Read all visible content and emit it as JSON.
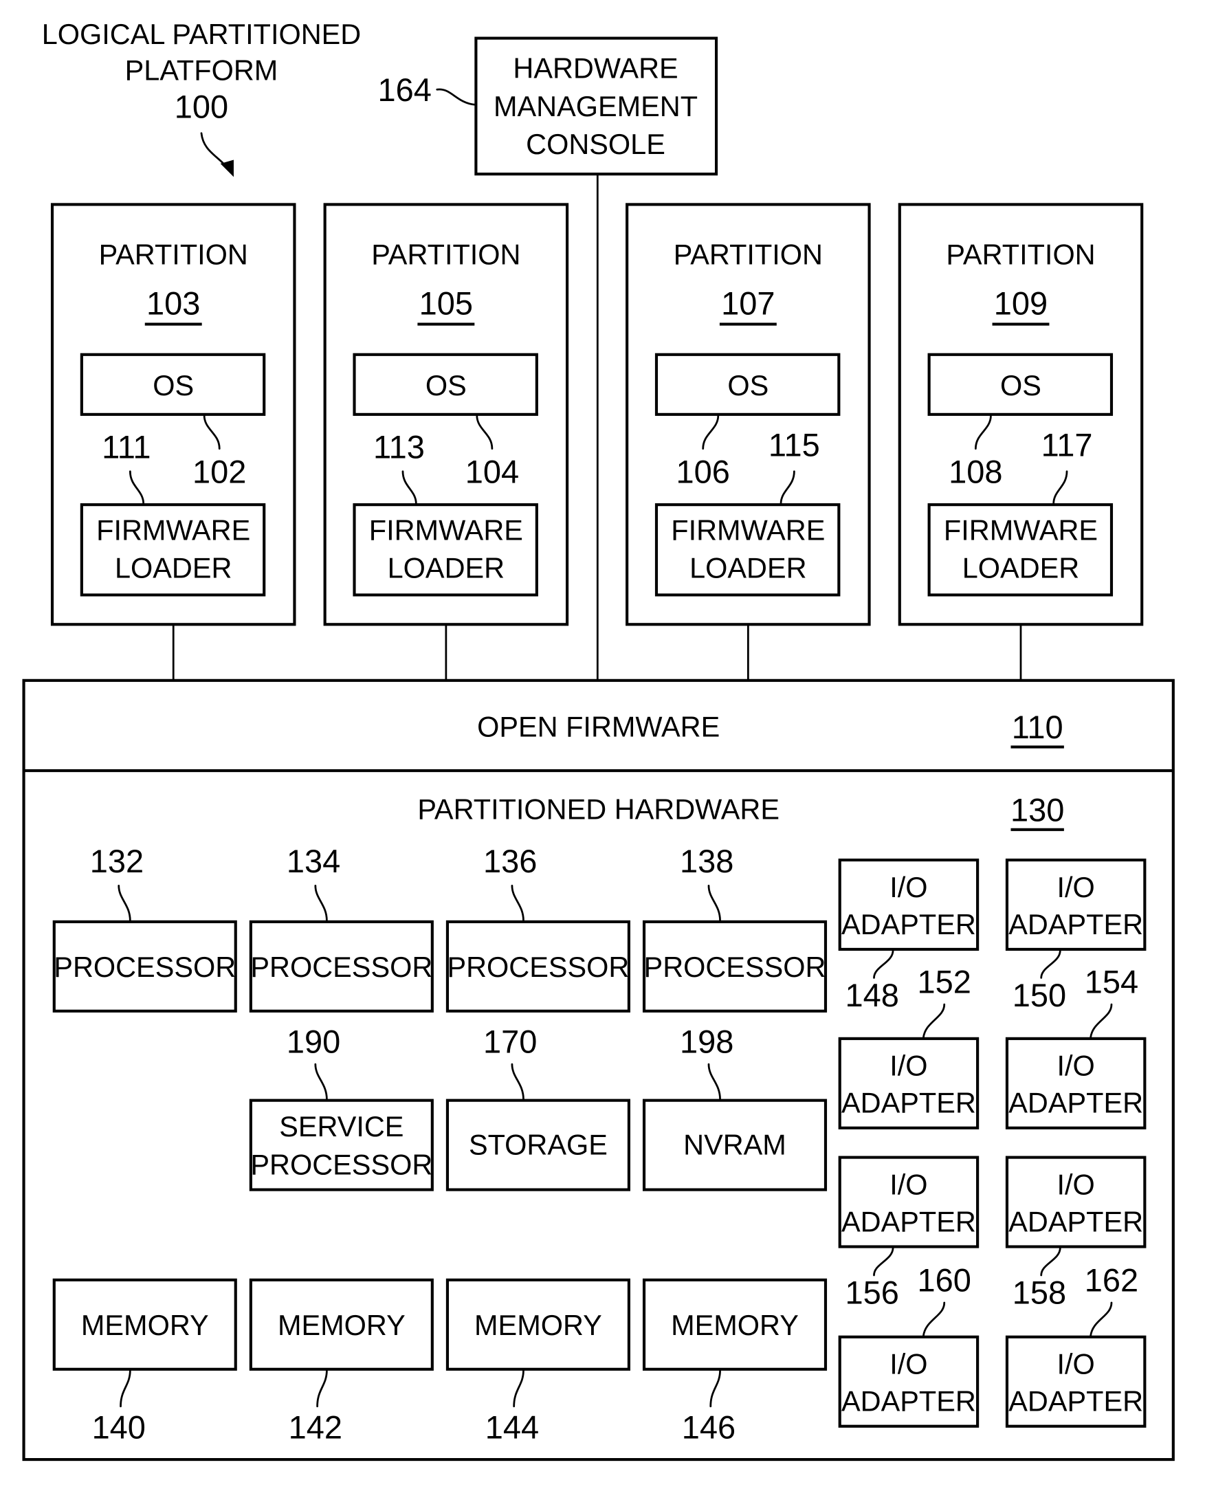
{
  "figure": {
    "title_line1": "LOGICAL PARTITIONED",
    "title_line2": "PLATFORM",
    "title_ref": "100"
  },
  "hmc": {
    "ref": "164",
    "line1": "HARDWARE",
    "line2": "MANAGEMENT",
    "line3": "CONSOLE"
  },
  "partitions": [
    {
      "label": "PARTITION",
      "ref": "103",
      "os": "OS",
      "os_ref": "102",
      "loader_line1": "FIRMWARE",
      "loader_line2": "LOADER",
      "loader_ref": "111"
    },
    {
      "label": "PARTITION",
      "ref": "105",
      "os": "OS",
      "os_ref": "104",
      "loader_line1": "FIRMWARE",
      "loader_line2": "LOADER",
      "loader_ref": "113"
    },
    {
      "label": "PARTITION",
      "ref": "107",
      "os": "OS",
      "os_ref": "106",
      "loader_line1": "FIRMWARE",
      "loader_line2": "LOADER",
      "loader_ref": "115"
    },
    {
      "label": "PARTITION",
      "ref": "109",
      "os": "OS",
      "os_ref": "108",
      "loader_line1": "FIRMWARE",
      "loader_line2": "LOADER",
      "loader_ref": "117"
    }
  ],
  "open_firmware": {
    "label": "OPEN FIRMWARE",
    "ref": "110"
  },
  "hardware": {
    "label": "PARTITIONED HARDWARE",
    "ref": "130",
    "processors": [
      {
        "label": "PROCESSOR",
        "ref": "132"
      },
      {
        "label": "PROCESSOR",
        "ref": "134"
      },
      {
        "label": "PROCESSOR",
        "ref": "136"
      },
      {
        "label": "PROCESSOR",
        "ref": "138"
      }
    ],
    "service_processor": {
      "line1": "SERVICE",
      "line2": "PROCESSOR",
      "ref": "190"
    },
    "storage": {
      "label": "STORAGE",
      "ref": "170"
    },
    "nvram": {
      "label": "NVRAM",
      "ref": "198"
    },
    "memories": [
      {
        "label": "MEMORY",
        "ref": "140"
      },
      {
        "label": "MEMORY",
        "ref": "142"
      },
      {
        "label": "MEMORY",
        "ref": "144"
      },
      {
        "label": "MEMORY",
        "ref": "146"
      }
    ],
    "io_adapters": [
      {
        "line1": "I/O",
        "line2": "ADAPTER",
        "ref": "148"
      },
      {
        "line1": "I/O",
        "line2": "ADAPTER",
        "ref": "150"
      },
      {
        "line1": "I/O",
        "line2": "ADAPTER",
        "ref": "152"
      },
      {
        "line1": "I/O",
        "line2": "ADAPTER",
        "ref": "154"
      },
      {
        "line1": "I/O",
        "line2": "ADAPTER",
        "ref": "156"
      },
      {
        "line1": "I/O",
        "line2": "ADAPTER",
        "ref": "158"
      },
      {
        "line1": "I/O",
        "line2": "ADAPTER",
        "ref": "160"
      },
      {
        "line1": "I/O",
        "line2": "ADAPTER",
        "ref": "162"
      }
    ]
  }
}
